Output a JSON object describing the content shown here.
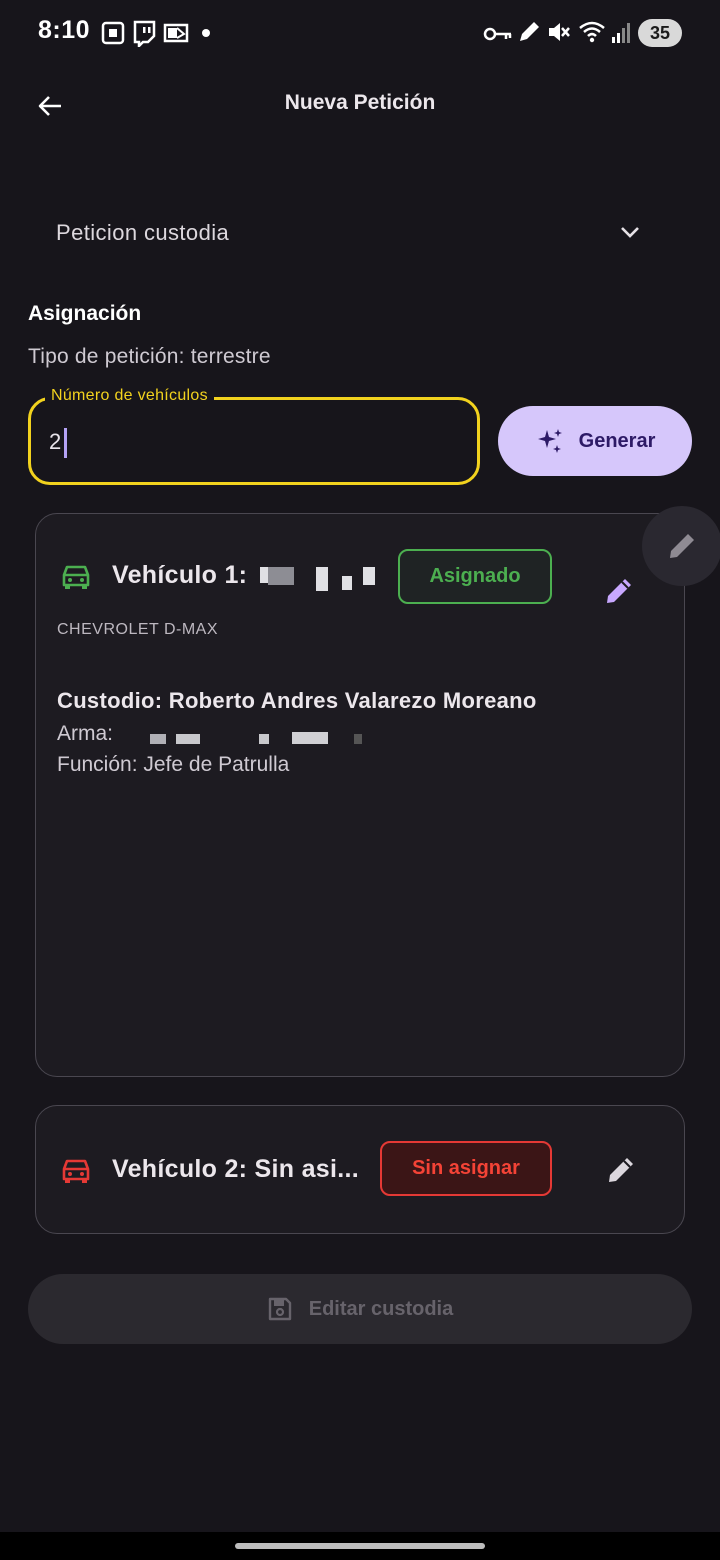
{
  "status_bar": {
    "time": "8:10",
    "battery": "35"
  },
  "app_bar": {
    "title": "Nueva Petición",
    "back_icon": "arrow-back-icon"
  },
  "dropdown": {
    "value": "Peticion custodia",
    "icon": "chevron-down-icon"
  },
  "assignment": {
    "section_title": "Asignación",
    "request_type": "Tipo de petición: terrestre",
    "vehicle_count_field": {
      "label": "Número de vehículos",
      "value": "2"
    },
    "generate_button": {
      "label": "Generar",
      "icon": "sparkles-icon"
    }
  },
  "vehicles": [
    {
      "title": "Vehículo 1:",
      "status": "Asignado",
      "status_color": "#4caf50",
      "icon": "car-icon",
      "icon_color": "#4caf50",
      "model": "CHEVROLET D-MAX",
      "custodian": "Custodio: Roberto Andres Valarezo Moreano",
      "weapon": "Arma:",
      "function": "Función: Jefe de Patrulla"
    },
    {
      "title": "Vehículo 2: Sin asi...",
      "status": "Sin asignar",
      "status_color": "#f44336",
      "icon": "car-icon",
      "icon_color": "#e53935"
    }
  ],
  "edit_custody_button": {
    "label": "Editar custodia",
    "icon": "save-icon"
  },
  "colors": {
    "background": "#17151b",
    "accent": "#d6c7fb",
    "focus": "#f2d21e"
  }
}
